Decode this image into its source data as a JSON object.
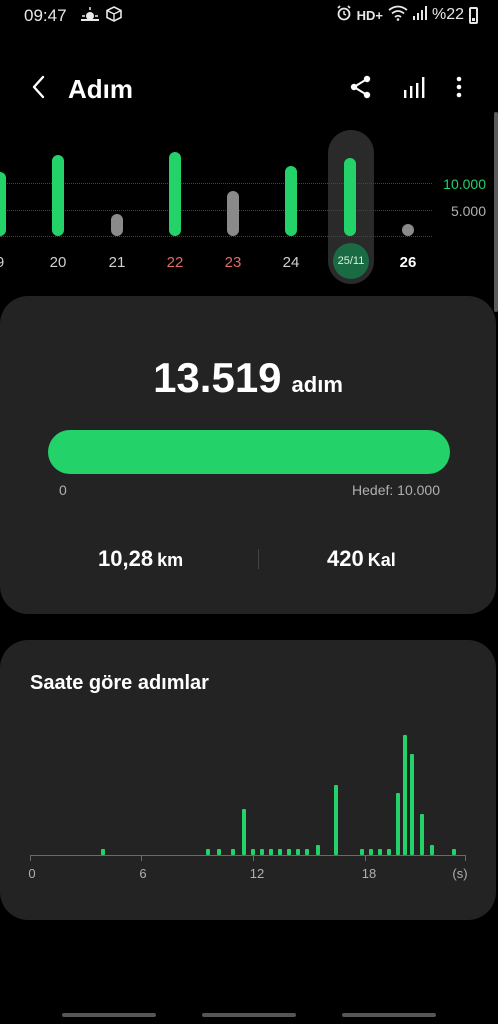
{
  "status_bar": {
    "time": "09:47",
    "network": "HD+",
    "battery": "%22"
  },
  "header": {
    "title": "Adım"
  },
  "week_chart": {
    "reference_lines": [
      "10.000",
      "5.000"
    ],
    "days": [
      {
        "label": "9",
        "steps": 11000,
        "color": "green"
      },
      {
        "label": "20",
        "steps": 14000,
        "color": "green"
      },
      {
        "label": "21",
        "steps": 3800,
        "color": "gray"
      },
      {
        "label": "22",
        "steps": 14500,
        "color": "green"
      },
      {
        "label": "23",
        "steps": 7800,
        "color": "gray"
      },
      {
        "label": "24",
        "steps": 12000,
        "color": "green"
      },
      {
        "label": "25/11",
        "steps": 13519,
        "color": "green",
        "selected": true
      },
      {
        "label": "26",
        "steps": 0,
        "color": "gray"
      }
    ]
  },
  "summary": {
    "steps": "13.519",
    "steps_unit": "adım",
    "progress_fraction": 1.0,
    "progress_min": "0",
    "goal_label": "Hedef: 10.000",
    "distance_value": "10,28",
    "distance_unit": "km",
    "calories_value": "420",
    "calories_unit": "Kal"
  },
  "hourly": {
    "title": "Saate göre adımlar",
    "x_ticks": [
      "0",
      "6",
      "12",
      "18",
      "(s)"
    ],
    "colors": {
      "bar": "#23d36a",
      "accent": "#23d36a"
    }
  },
  "chart_data": {
    "type": "bar",
    "title": "Saate göre adımlar",
    "xlabel": "(s)",
    "ylabel": "",
    "x_tick_labels": [
      "0",
      "6",
      "12",
      "18"
    ],
    "categories": [
      "4",
      "9.8",
      "10.4",
      "11.2",
      "11.8",
      "12.3",
      "12.8",
      "13.3",
      "13.8",
      "14.3",
      "14.8",
      "15.3",
      "15.9",
      "16.9",
      "18.3",
      "18.8",
      "19.3",
      "19.8",
      "20.3",
      "20.7",
      "21.1",
      "21.6",
      "22.2",
      "23.4"
    ],
    "values": [
      50,
      50,
      50,
      50,
      380,
      50,
      50,
      50,
      50,
      50,
      50,
      50,
      80,
      580,
      50,
      50,
      50,
      50,
      520,
      1000,
      840,
      340,
      80,
      50
    ],
    "xlim": [
      0,
      24
    ]
  }
}
